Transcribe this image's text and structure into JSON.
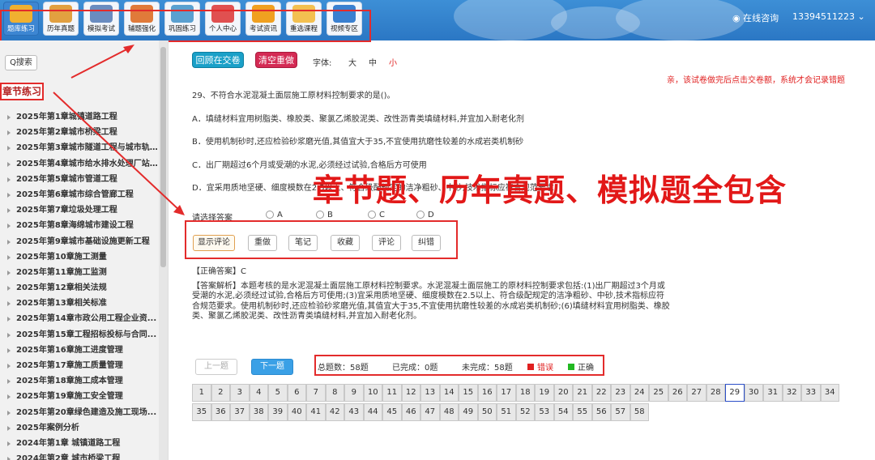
{
  "header": {
    "nav": [
      {
        "label": "题库练习",
        "active": true,
        "icon": "book-icon"
      },
      {
        "label": "历年真题",
        "icon": "papers-icon"
      },
      {
        "label": "模拟考试",
        "icon": "pen-icon"
      },
      {
        "label": "辅题强化",
        "icon": "pencil-icon"
      },
      {
        "label": "巩固练习",
        "icon": "notebook-icon"
      },
      {
        "label": "个人中心",
        "icon": "person-icon"
      },
      {
        "label": "考试资讯",
        "icon": "tools-icon"
      },
      {
        "label": "重选课程",
        "icon": "clipboard-icon"
      },
      {
        "label": "视频专区",
        "icon": "video-icon"
      }
    ],
    "online": "在线咨询",
    "phone": "13394511223"
  },
  "sidebar": {
    "search": "Q搜索",
    "heading": "章节练习",
    "chapters": [
      "2025年第1章城镇道路工程",
      "2025年第2章城市桥梁工程",
      "2025年第3章城市隧道工程与城市轨...",
      "2025年第4章城市给水排水处理厂站...",
      "2025年第5章城市管道工程",
      "2025年第6章城市综合管廊工程",
      "2025年第7章垃圾处理工程",
      "2025年第8章海绵城市建设工程",
      "2025年第9章城市基础设施更新工程",
      "2025年第10章施工测量",
      "2025年第11章施工监测",
      "2025年第12章相关法规",
      "2025年第13章相关标准",
      "2025年第14章市政公用工程企业资...",
      "2025年第15章工程招标投标与合同...",
      "2025年第16章施工进度管理",
      "2025年第17章施工质量管理",
      "2025年第18章施工成本管理",
      "2025年第19章施工安全管理",
      "2025年第20章绿色建造及施工现场...",
      "2025年案例分析",
      "2024年第1章 城镇道路工程",
      "2024年第2章 城市桥梁工程"
    ]
  },
  "main": {
    "submit": "回顾在交卷",
    "clear": "清空重做",
    "font_label": "字体:",
    "font_sizes": [
      "大",
      "中",
      "小"
    ],
    "notice": "亲，该试卷做完后点击交卷额，系统才会记录错题",
    "question": "29、不符合水泥混凝土面层施工原材料控制要求的是()。",
    "options": [
      "A．填缝材料宜用树脂类、橡胶类、聚氯乙烯胶泥类、改性沥青类填缝材料,并宜加入耐老化剂",
      "B．使用机制砂时,还应检验砂浆磨光值,其值宜大于35,不宜使用抗磨性较差的水成岩类机制砂",
      "C．出厂期超过6个月或受潮的水泥,必须经过试验,合格后方可使用",
      "D．宜采用质地坚硬、细度模数在2.5以上、符合级配规定的洁净粗砂、中砂,技术指标应符合规范要求"
    ],
    "overlay": "章节题、历年真题、模拟题全包含",
    "choose_label": "请选择答案",
    "choices": [
      "A",
      "B",
      "C",
      "D"
    ],
    "actions": [
      "显示评论",
      "重做",
      "笔记",
      "收藏",
      "评论",
      "纠错"
    ],
    "answer_label": "【正确答案】C",
    "explain": "【答案解析】本题考核的是水泥混凝土面层施工原材料控制要求。水泥混凝土面层施工的原材料控制要求包括:(1)出厂期超过3个月或受潮的水泥,必须经过试验,合格后方可使用;(3)宜采用质地坚硬、细度模数在2.5以上、符合级配规定的洁净粗砂、中砂,技术指标应符合规范要求。使用机制砂时,还应检验砂浆磨光值,其值宜大于35,不宜使用抗磨性较差的水成岩类机制砂;(6)填缝材料宜用树脂类、橡胶类、聚氯乙烯胶泥类、改性沥青类填缝材料,并宜加入耐老化剂。",
    "prev": "上一题",
    "next": "下一题",
    "total": "总题数：58题",
    "done": "已完成：0题",
    "undone": "未完成：58题",
    "wrong": "错误",
    "right": "正确",
    "colors": {
      "wrong": "#e02020",
      "right": "#22b822"
    },
    "question_count": 58,
    "current": 29
  }
}
